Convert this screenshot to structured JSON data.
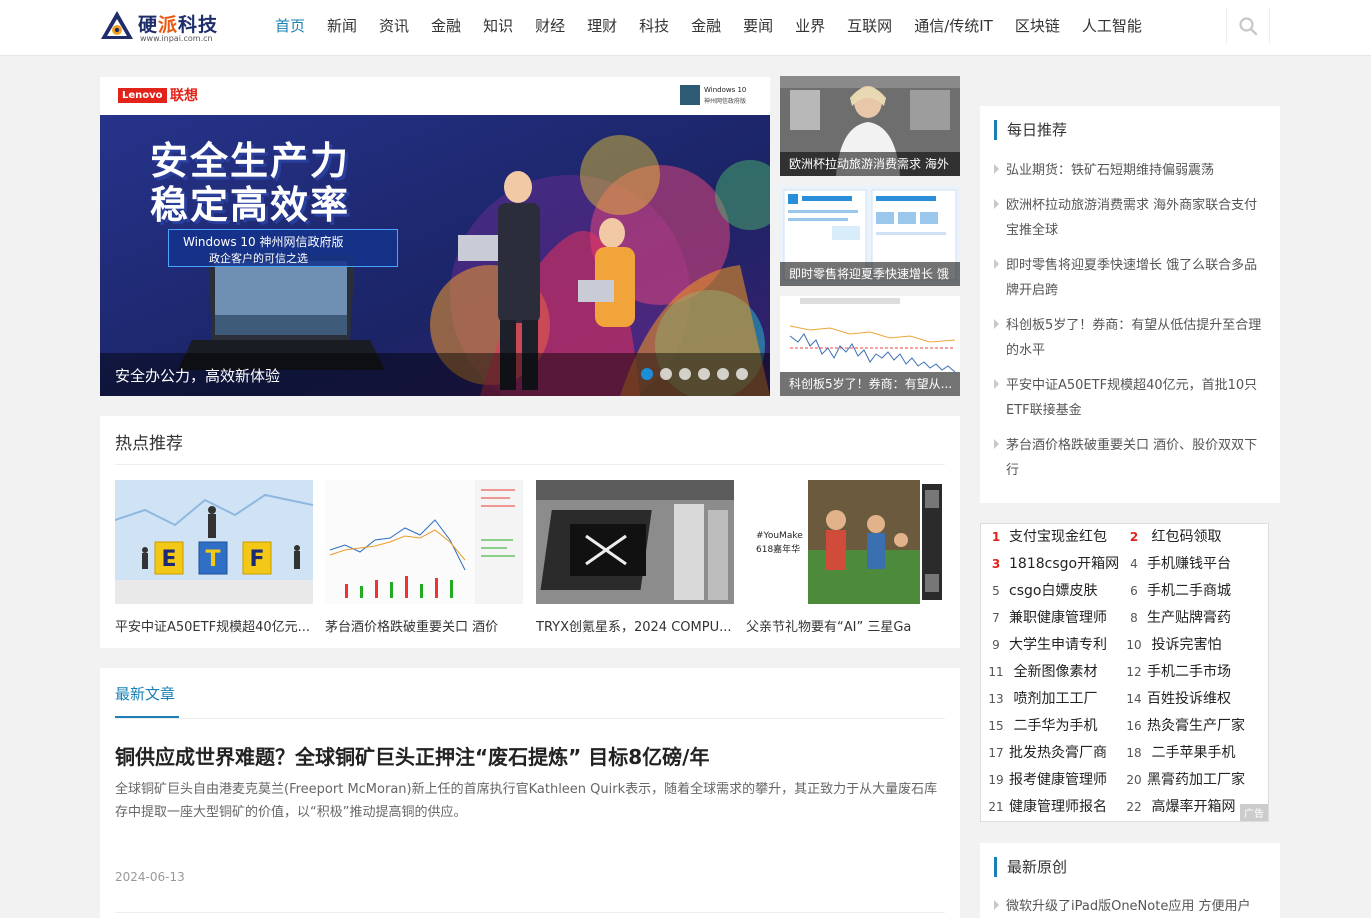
{
  "logo": {
    "name_part1": "硬",
    "name_part2": "派",
    "name_part3": "科技",
    "url": "www.inpai.com.cn"
  },
  "nav": {
    "items": [
      {
        "label": "首页",
        "active": true
      },
      {
        "label": "新闻"
      },
      {
        "label": "资讯"
      },
      {
        "label": "金融"
      },
      {
        "label": "知识"
      },
      {
        "label": "财经"
      },
      {
        "label": "理财"
      },
      {
        "label": "科技"
      },
      {
        "label": "金融"
      },
      {
        "label": "要闻"
      },
      {
        "label": "业界"
      },
      {
        "label": "互联网"
      },
      {
        "label": "通信/传统IT"
      },
      {
        "label": "区块链"
      },
      {
        "label": "人工智能"
      }
    ],
    "search_icon": "search-icon"
  },
  "slider": {
    "brand_badge": "Lenovo",
    "brand_cn": "联想",
    "win_line1": "Windows 10",
    "win_line2": "神州网信政府版",
    "headline_line1": "安全生产力",
    "headline_line2": "稳定高效率",
    "sub_line1": "Windows 10 神州网信政府版",
    "sub_line2": "政企客户的可信之选",
    "caption": "安全办公力，高效新体验",
    "dots": 6,
    "active_dot": 0
  },
  "side_thumbs": [
    {
      "caption": "欧洲杯拉动旅游消费需求 海外"
    },
    {
      "caption": "即时零售将迎夏季快速增长 饿"
    },
    {
      "caption": "科创板5岁了！券商：有望从..."
    }
  ],
  "hot": {
    "title": "热点推荐",
    "etf_text": "ETF",
    "cards": [
      {
        "caption": "平安中证A50ETF规模超40亿元..."
      },
      {
        "caption": "茅台酒价格跌破重要关口 酒价"
      },
      {
        "caption": "TRYX创氪星系，2024 COMPU..."
      },
      {
        "caption": "父亲节礼物要有“AI” 三星Ga"
      }
    ],
    "card4_overlay": "#YouMake\n618嘉年华"
  },
  "latest": {
    "tab": "最新文章",
    "article": {
      "title": "铜供应成世界难题？全球铜矿巨头正押注“废石提炼” 目标8亿磅/年",
      "desc": "全球铜矿巨头自由港麦克莫兰(Freeport McMoran)新上任的首席执行官Kathleen Quirk表示，随着全球需求的攀升，其正致力于从大量废石库存中提取一座大型铜矿的价值，以“积极”推动提高铜的供应。",
      "date": "2024-06-13"
    }
  },
  "daily": {
    "title": "每日推荐",
    "items": [
      "弘业期货：铁矿石短期维持偏弱震荡",
      "欧洲杯拉动旅游消费需求 海外商家联合支付宝推全球",
      "即时零售将迎夏季快速增长 饿了么联合多品牌开启跨",
      "科创板5岁了！券商：有望从低估提升至合理的水平",
      "平安中证A50ETF规模超40亿元，首批10只ETF联接基金",
      "茅台酒价格跌破重要关口 酒价、股价双双下行"
    ]
  },
  "ad": {
    "label": "广告",
    "rows": [
      [
        {
          "num": "1",
          "text": "支付宝现金红包"
        },
        {
          "num": "2",
          "text": "红包码领取"
        }
      ],
      [
        {
          "num": "3",
          "text": "1818csgo开箱网"
        },
        {
          "num": "4",
          "text": "手机赚钱平台"
        }
      ],
      [
        {
          "num": "5",
          "text": "csgo白嫖皮肤"
        },
        {
          "num": "6",
          "text": "手机二手商城"
        }
      ],
      [
        {
          "num": "7",
          "text": "兼职健康管理师"
        },
        {
          "num": "8",
          "text": "生产贴牌膏药"
        }
      ],
      [
        {
          "num": "9",
          "text": "大学生申请专利"
        },
        {
          "num": "10",
          "text": "投诉完害怕"
        }
      ],
      [
        {
          "num": "11",
          "text": "全新图像素材"
        },
        {
          "num": "12",
          "text": "手机二手市场"
        }
      ],
      [
        {
          "num": "13",
          "text": "喷剂加工工厂"
        },
        {
          "num": "14",
          "text": "百姓投诉维权"
        }
      ],
      [
        {
          "num": "15",
          "text": "二手华为手机"
        },
        {
          "num": "16",
          "text": "热灸膏生产厂家"
        }
      ],
      [
        {
          "num": "17",
          "text": "批发热灸膏厂商"
        },
        {
          "num": "18",
          "text": "二手苹果手机"
        }
      ],
      [
        {
          "num": "19",
          "text": "报考健康管理师"
        },
        {
          "num": "20",
          "text": "黑膏药加工厂家"
        }
      ],
      [
        {
          "num": "21",
          "text": "健康管理师报名"
        },
        {
          "num": "22",
          "text": "高爆率开箱网"
        }
      ]
    ]
  },
  "original": {
    "title": "最新原创",
    "items": [
      "微软升级了iPad版OneNote应用 方便用户"
    ]
  }
}
